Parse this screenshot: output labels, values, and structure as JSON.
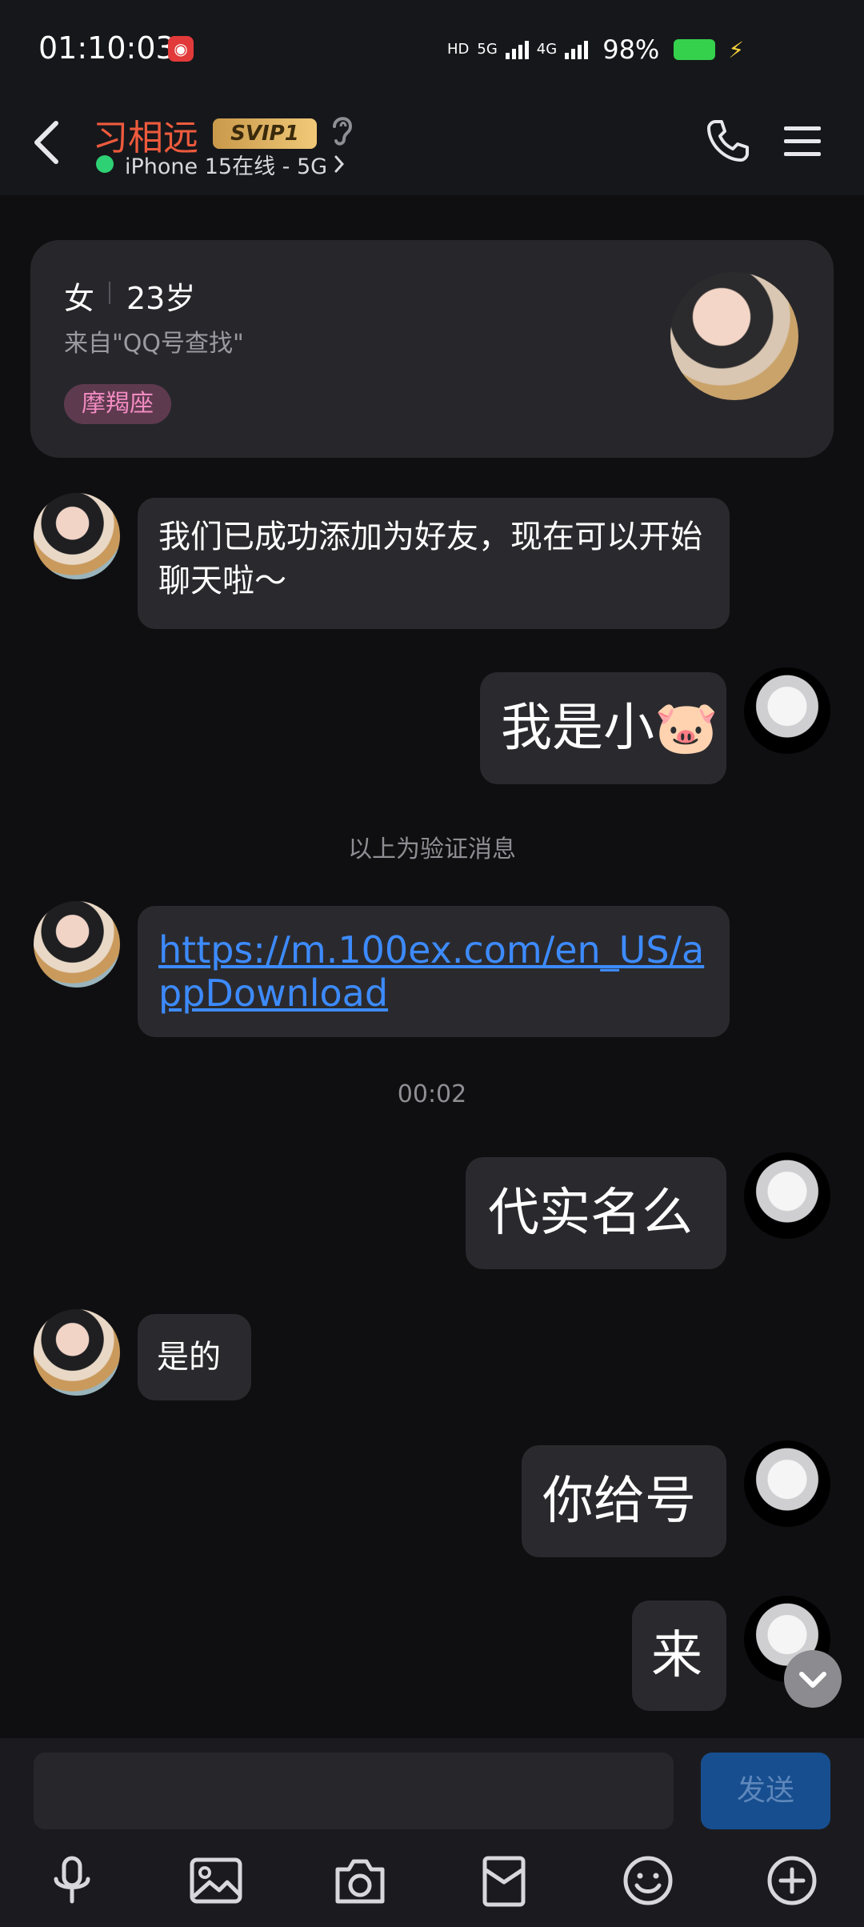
{
  "status_bar": {
    "time": "01:10:03",
    "hd_label": "HD",
    "net_5g": "5G",
    "net_4g": "4G",
    "battery": "98%"
  },
  "header": {
    "contact_name": "习相远",
    "vip_badge": "SVIP1",
    "device_status": "iPhone 15在线 - 5G"
  },
  "profile_card": {
    "gender": "女",
    "age": "23岁",
    "source": "来自\"QQ号查找\"",
    "zodiac": "摩羯座"
  },
  "messages": [
    {
      "side": "left",
      "text": "我们已成功添加为好友，现在可以开始聊天啦～"
    },
    {
      "side": "right",
      "text": "我是小🐷"
    },
    {
      "side": "left",
      "text": "https://m.100ex.com/en_US/appDownload"
    },
    {
      "side": "right",
      "text": "代实名么"
    },
    {
      "side": "left",
      "text": "是的"
    },
    {
      "side": "right",
      "text": "你给号"
    },
    {
      "side": "right",
      "text": "来"
    }
  ],
  "system_notes": {
    "verify": "以上为验证消息",
    "time": "00:02"
  },
  "composer": {
    "placeholder": "",
    "send_label": "发送"
  },
  "toolbar": [
    "microphone-icon",
    "image-icon",
    "camera-icon",
    "red-packet-icon",
    "emoji-icon",
    "plus-icon"
  ]
}
